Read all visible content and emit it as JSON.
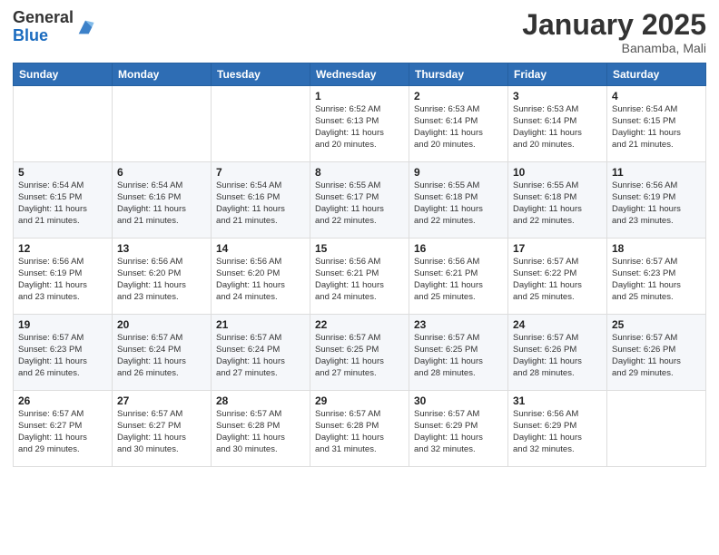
{
  "logo": {
    "general": "General",
    "blue": "Blue"
  },
  "header": {
    "month": "January 2025",
    "location": "Banamba, Mali"
  },
  "weekdays": [
    "Sunday",
    "Monday",
    "Tuesday",
    "Wednesday",
    "Thursday",
    "Friday",
    "Saturday"
  ],
  "weeks": [
    [
      {
        "day": "",
        "info": ""
      },
      {
        "day": "",
        "info": ""
      },
      {
        "day": "",
        "info": ""
      },
      {
        "day": "1",
        "info": "Sunrise: 6:52 AM\nSunset: 6:13 PM\nDaylight: 11 hours\nand 20 minutes."
      },
      {
        "day": "2",
        "info": "Sunrise: 6:53 AM\nSunset: 6:14 PM\nDaylight: 11 hours\nand 20 minutes."
      },
      {
        "day": "3",
        "info": "Sunrise: 6:53 AM\nSunset: 6:14 PM\nDaylight: 11 hours\nand 20 minutes."
      },
      {
        "day": "4",
        "info": "Sunrise: 6:54 AM\nSunset: 6:15 PM\nDaylight: 11 hours\nand 21 minutes."
      }
    ],
    [
      {
        "day": "5",
        "info": "Sunrise: 6:54 AM\nSunset: 6:15 PM\nDaylight: 11 hours\nand 21 minutes."
      },
      {
        "day": "6",
        "info": "Sunrise: 6:54 AM\nSunset: 6:16 PM\nDaylight: 11 hours\nand 21 minutes."
      },
      {
        "day": "7",
        "info": "Sunrise: 6:54 AM\nSunset: 6:16 PM\nDaylight: 11 hours\nand 21 minutes."
      },
      {
        "day": "8",
        "info": "Sunrise: 6:55 AM\nSunset: 6:17 PM\nDaylight: 11 hours\nand 22 minutes."
      },
      {
        "day": "9",
        "info": "Sunrise: 6:55 AM\nSunset: 6:18 PM\nDaylight: 11 hours\nand 22 minutes."
      },
      {
        "day": "10",
        "info": "Sunrise: 6:55 AM\nSunset: 6:18 PM\nDaylight: 11 hours\nand 22 minutes."
      },
      {
        "day": "11",
        "info": "Sunrise: 6:56 AM\nSunset: 6:19 PM\nDaylight: 11 hours\nand 23 minutes."
      }
    ],
    [
      {
        "day": "12",
        "info": "Sunrise: 6:56 AM\nSunset: 6:19 PM\nDaylight: 11 hours\nand 23 minutes."
      },
      {
        "day": "13",
        "info": "Sunrise: 6:56 AM\nSunset: 6:20 PM\nDaylight: 11 hours\nand 23 minutes."
      },
      {
        "day": "14",
        "info": "Sunrise: 6:56 AM\nSunset: 6:20 PM\nDaylight: 11 hours\nand 24 minutes."
      },
      {
        "day": "15",
        "info": "Sunrise: 6:56 AM\nSunset: 6:21 PM\nDaylight: 11 hours\nand 24 minutes."
      },
      {
        "day": "16",
        "info": "Sunrise: 6:56 AM\nSunset: 6:21 PM\nDaylight: 11 hours\nand 25 minutes."
      },
      {
        "day": "17",
        "info": "Sunrise: 6:57 AM\nSunset: 6:22 PM\nDaylight: 11 hours\nand 25 minutes."
      },
      {
        "day": "18",
        "info": "Sunrise: 6:57 AM\nSunset: 6:23 PM\nDaylight: 11 hours\nand 25 minutes."
      }
    ],
    [
      {
        "day": "19",
        "info": "Sunrise: 6:57 AM\nSunset: 6:23 PM\nDaylight: 11 hours\nand 26 minutes."
      },
      {
        "day": "20",
        "info": "Sunrise: 6:57 AM\nSunset: 6:24 PM\nDaylight: 11 hours\nand 26 minutes."
      },
      {
        "day": "21",
        "info": "Sunrise: 6:57 AM\nSunset: 6:24 PM\nDaylight: 11 hours\nand 27 minutes."
      },
      {
        "day": "22",
        "info": "Sunrise: 6:57 AM\nSunset: 6:25 PM\nDaylight: 11 hours\nand 27 minutes."
      },
      {
        "day": "23",
        "info": "Sunrise: 6:57 AM\nSunset: 6:25 PM\nDaylight: 11 hours\nand 28 minutes."
      },
      {
        "day": "24",
        "info": "Sunrise: 6:57 AM\nSunset: 6:26 PM\nDaylight: 11 hours\nand 28 minutes."
      },
      {
        "day": "25",
        "info": "Sunrise: 6:57 AM\nSunset: 6:26 PM\nDaylight: 11 hours\nand 29 minutes."
      }
    ],
    [
      {
        "day": "26",
        "info": "Sunrise: 6:57 AM\nSunset: 6:27 PM\nDaylight: 11 hours\nand 29 minutes."
      },
      {
        "day": "27",
        "info": "Sunrise: 6:57 AM\nSunset: 6:27 PM\nDaylight: 11 hours\nand 30 minutes."
      },
      {
        "day": "28",
        "info": "Sunrise: 6:57 AM\nSunset: 6:28 PM\nDaylight: 11 hours\nand 30 minutes."
      },
      {
        "day": "29",
        "info": "Sunrise: 6:57 AM\nSunset: 6:28 PM\nDaylight: 11 hours\nand 31 minutes."
      },
      {
        "day": "30",
        "info": "Sunrise: 6:57 AM\nSunset: 6:29 PM\nDaylight: 11 hours\nand 32 minutes."
      },
      {
        "day": "31",
        "info": "Sunrise: 6:56 AM\nSunset: 6:29 PM\nDaylight: 11 hours\nand 32 minutes."
      },
      {
        "day": "",
        "info": ""
      }
    ]
  ]
}
